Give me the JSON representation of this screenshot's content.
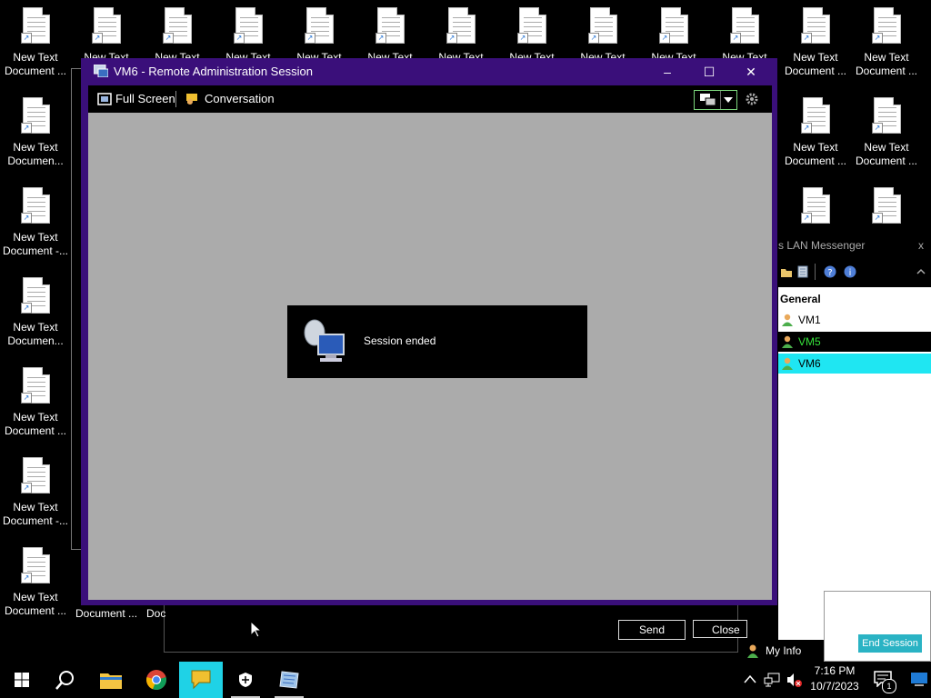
{
  "desktop": {
    "icon_label_a": "New Text Document ...",
    "icon_label_b": "New Text Documen...",
    "icon_label_c": "New Text Document -...",
    "icon_label_top": "New Text"
  },
  "ra_window": {
    "title": "VM6 - Remote Administration Session",
    "minimize": "‒",
    "maximize": "☐",
    "close": "✕",
    "toolbar": {
      "full_screen": "Full Screen",
      "conversation": "Conversation"
    },
    "session_message": "Session ended"
  },
  "background": {
    "send_label": "Send",
    "close_label": "Close",
    "doc_label_1": "Document ...",
    "doc_label_2": "Doc"
  },
  "messenger": {
    "title": "s LAN Messenger",
    "close": "x",
    "group": "General",
    "contacts": [
      {
        "name": "VM1",
        "color": "#000000",
        "bg": "#ffffff"
      },
      {
        "name": "VM5",
        "color": "#35e23a",
        "bg": "#000000"
      },
      {
        "name": "VM6",
        "color": "#000000",
        "bg": "#1fe6f2"
      }
    ],
    "my_info": "My Info",
    "end_session": "End Session"
  },
  "taskbar": {
    "time": "7:16 PM",
    "date": "10/7/2023",
    "notification_count": "1",
    "accent": "#1fd2e6"
  }
}
